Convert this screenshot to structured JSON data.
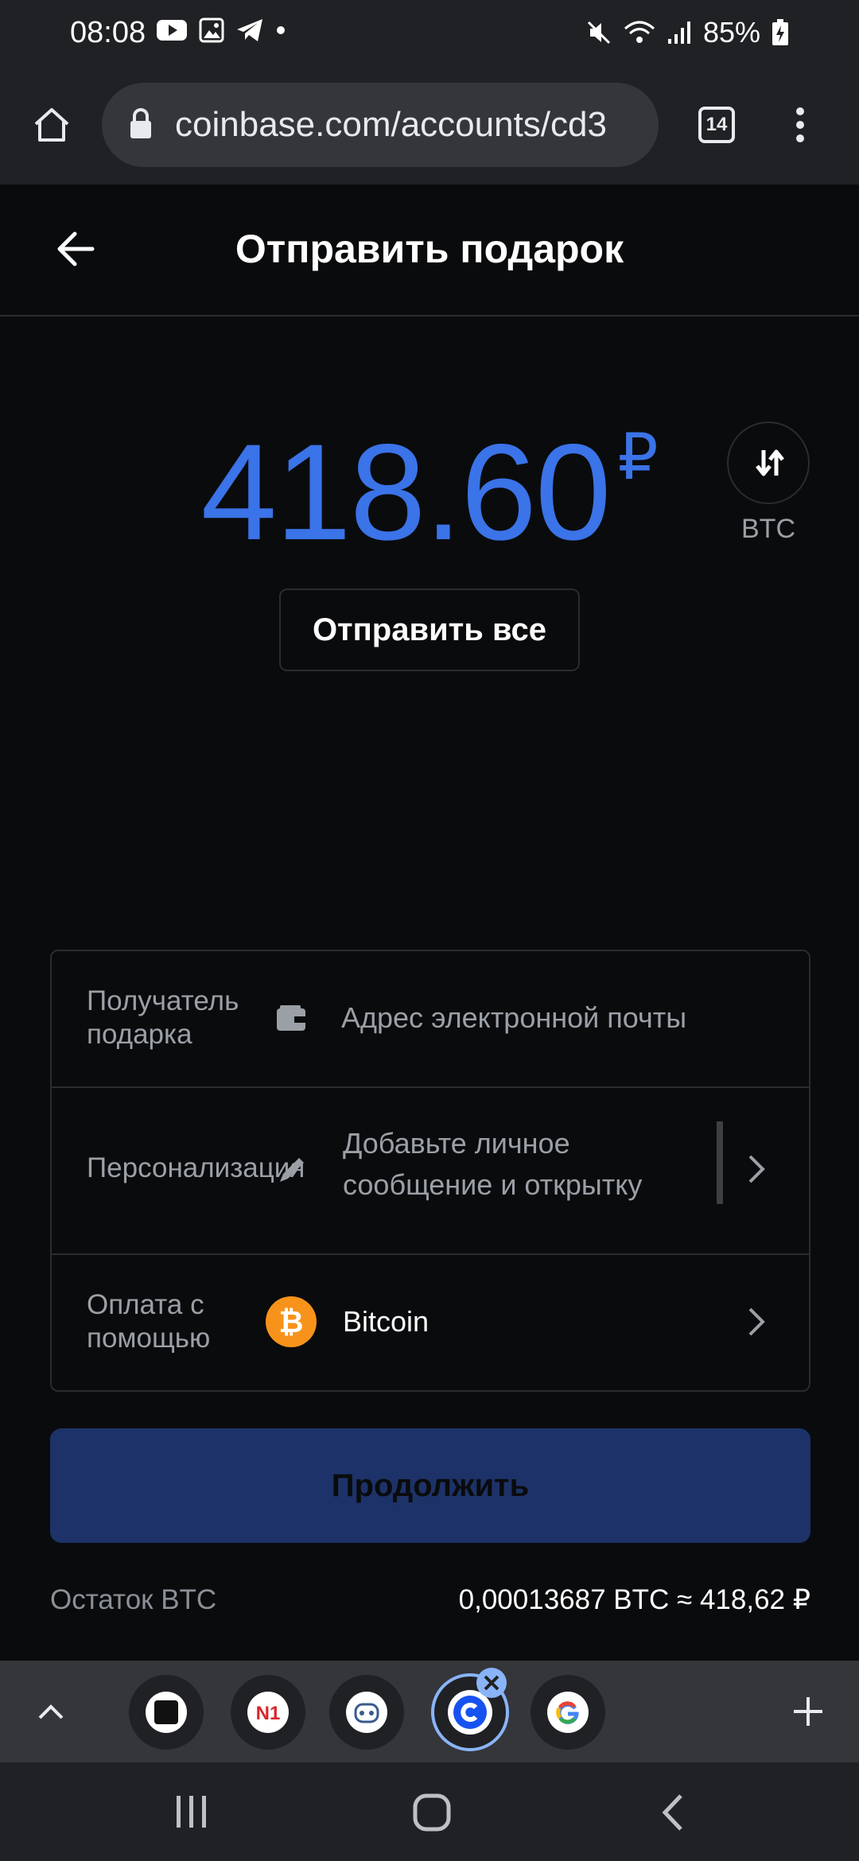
{
  "status_bar": {
    "time": "08:08",
    "battery": "85%"
  },
  "browser": {
    "url": "coinbase.com/accounts/cd3",
    "tab_count": "14"
  },
  "header": {
    "title": "Отправить подарок"
  },
  "amount": {
    "value": "418.60",
    "currency_symbol": "₽",
    "toggle_label": "BTC",
    "send_all_label": "Отправить все"
  },
  "form": {
    "recipient": {
      "label": "Получатель подарка",
      "placeholder": "Адрес электронной почты"
    },
    "personalization": {
      "label": "Персонализация",
      "value": "Добавьте личное сообщение и открытку"
    },
    "payment": {
      "label": "Оплата с помощью",
      "value": "Bitcoin"
    }
  },
  "continue_label": "Продолжить",
  "balance": {
    "label": "Остаток BTC",
    "value": "0,00013687 BTC ≈ 418,62 ₽"
  },
  "tabs": [
    {
      "name": "tab-terminal",
      "icon": "terminal-icon"
    },
    {
      "name": "tab-n1",
      "icon": "n1-icon",
      "text": "N1"
    },
    {
      "name": "tab-game",
      "icon": "game-icon"
    },
    {
      "name": "tab-coinbase",
      "icon": "coinbase-icon",
      "active": true
    },
    {
      "name": "tab-google",
      "icon": "google-icon"
    }
  ],
  "colors": {
    "accent": "#3b73e8",
    "continue_bg": "#1d3268",
    "bitcoin": "#f7931a",
    "background": "#0a0b0d"
  }
}
